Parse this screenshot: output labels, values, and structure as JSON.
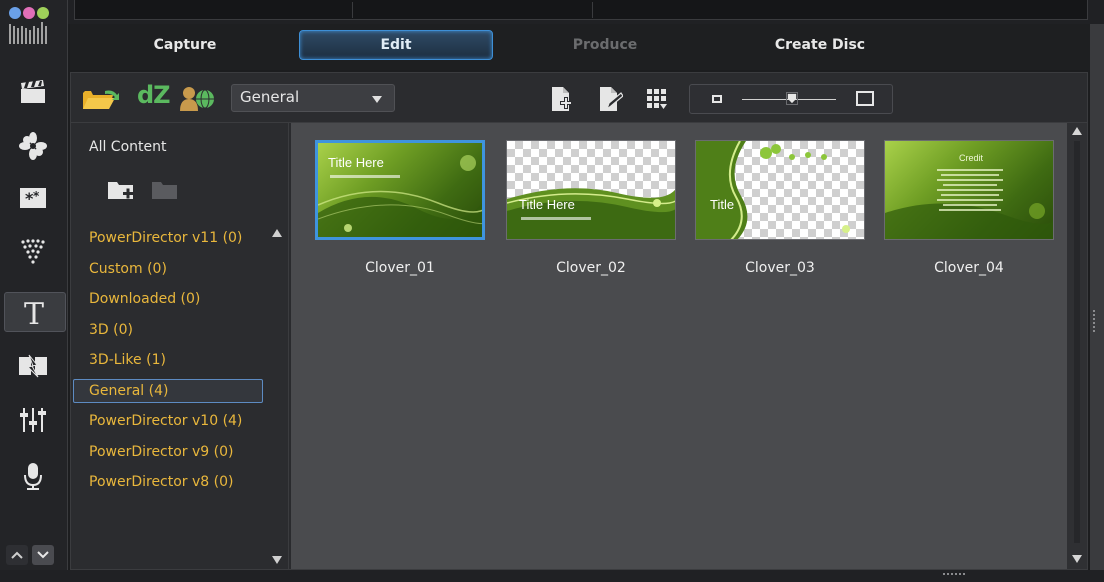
{
  "mode_tabs": {
    "capture": "Capture",
    "edit": "Edit",
    "produce": "Produce",
    "create_disc": "Create Disc"
  },
  "rail": {
    "items": [
      {
        "name": "media-room-icon"
      },
      {
        "name": "fx-room-icon"
      },
      {
        "name": "pip-designer-icon"
      },
      {
        "name": "particle-room-icon"
      },
      {
        "name": "title-room-icon",
        "active": true
      },
      {
        "name": "transition-room-icon"
      },
      {
        "name": "audio-mixer-icon"
      },
      {
        "name": "voice-over-icon"
      }
    ]
  },
  "toolbar": {
    "dz_label": "dZ",
    "category_select": "General",
    "icons": [
      "import-folder-icon",
      "directorzone-icon",
      "freetemplates-icon",
      "add-title-icon",
      "edit-title-icon",
      "view-mode-icon"
    ]
  },
  "categories": {
    "all_content": "All Content",
    "items": [
      {
        "label": "PowerDirector v11  (0)"
      },
      {
        "label": "Custom  (0)"
      },
      {
        "label": "Downloaded  (0)"
      },
      {
        "label": "3D  (0)"
      },
      {
        "label": "3D-Like  (1)"
      },
      {
        "label": "General  (4)",
        "selected": true
      },
      {
        "label": "PowerDirector v10  (4)"
      },
      {
        "label": "PowerDirector v9  (0)"
      },
      {
        "label": "PowerDirector v8  (0)"
      }
    ]
  },
  "thumbnails": [
    {
      "label": "Clover_01",
      "title_text": "Title Here",
      "selected": true
    },
    {
      "label": "Clover_02",
      "title_text": "Title Here"
    },
    {
      "label": "Clover_03",
      "title_text": "Title"
    },
    {
      "label": "Clover_04",
      "title_text": "Credit"
    }
  ],
  "colors": {
    "accent": "#3f94de",
    "category_text": "#e9b73c",
    "dz_green": "#5bb95f"
  }
}
